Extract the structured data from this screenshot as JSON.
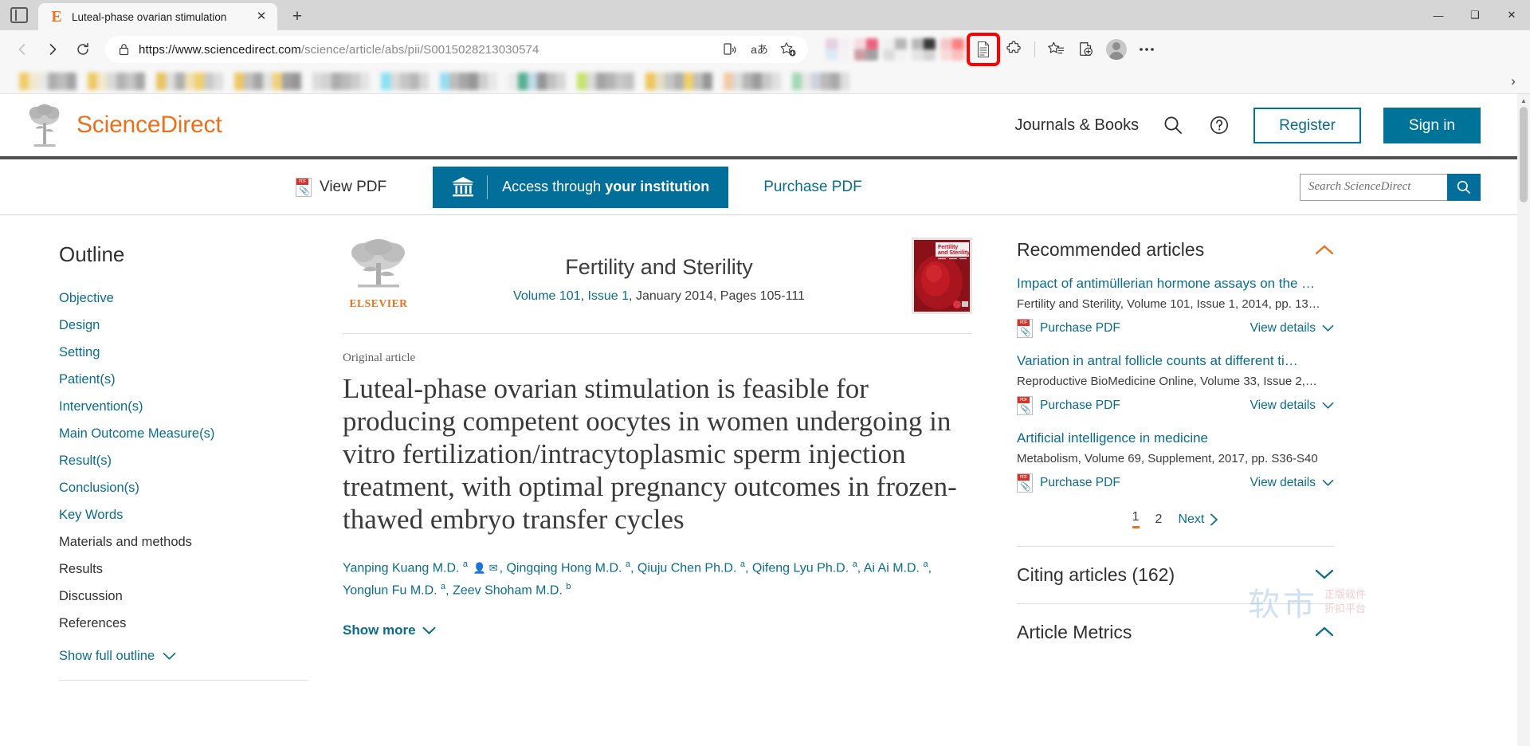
{
  "browser": {
    "tab": {
      "title": "Luteal-phase ovarian stimulation",
      "favicon": "E",
      "close": "✕"
    },
    "new_tab": "+",
    "window_controls": {
      "minimize": "—",
      "maximize": "❑",
      "close": "✕"
    },
    "nav": {
      "back": "←",
      "forward": "→",
      "reload": "↻"
    },
    "omnibox": {
      "lock": "lock-icon",
      "url_host": "https://www.sciencedirect.com",
      "url_path": "/science/article/abs/pii/S0015028213030574",
      "read_aloud": "read-aloud-icon",
      "translate": "aあ",
      "favorite": "favorite-add-icon"
    },
    "toolbar": {
      "reading_view": "reading-view-icon",
      "extensions": "extensions-icon",
      "favorites": "favorites-icon",
      "collections": "collections-icon",
      "profile": "profile-avatar",
      "settings": "settings-more-icon"
    },
    "bookmarks_overflow": "›"
  },
  "site": {
    "brand": "ScienceDirect",
    "nav": {
      "journals_books": "Journals & Books",
      "search_icon": "search-icon",
      "help_icon": "help-icon",
      "register": "Register",
      "sign_in": "Sign in"
    },
    "action_bar": {
      "view_pdf": "View PDF",
      "access_prefix": "Access through ",
      "access_bold": "your institution",
      "purchase_pdf": "Purchase PDF",
      "search_placeholder": "Search ScienceDirect",
      "search_value": "Search ScienceDirect",
      "search_button": "search-icon"
    }
  },
  "outline": {
    "title": "Outline",
    "items": [
      {
        "label": "Objective",
        "link": true
      },
      {
        "label": "Design",
        "link": true
      },
      {
        "label": "Setting",
        "link": true
      },
      {
        "label": "Patient(s)",
        "link": true
      },
      {
        "label": "Intervention(s)",
        "link": true
      },
      {
        "label": "Main Outcome Measure(s)",
        "link": true
      },
      {
        "label": "Result(s)",
        "link": true
      },
      {
        "label": "Conclusion(s)",
        "link": true
      },
      {
        "label": "Key Words",
        "link": true
      },
      {
        "label": "Materials and methods",
        "link": false
      },
      {
        "label": "Results",
        "link": false
      },
      {
        "label": "Discussion",
        "link": false
      },
      {
        "label": "References",
        "link": false
      }
    ],
    "show_full": "Show full outline"
  },
  "article": {
    "publisher": "ELSEVIER",
    "journal_name": "Fertility and Sterility",
    "volume": "Volume 101",
    "issue": "Issue 1",
    "volume_rest": ", January 2014, Pages 105-111",
    "cover_title_line1": "Fertility",
    "cover_title_line2": "and Sterility",
    "type": "Original article",
    "title": "Luteal-phase ovarian stimulation is feasible for producing competent oocytes in women undergoing in vitro fertilization/intracytoplasmic sperm injection treatment, with optimal pregnancy outcomes in frozen-thawed embryo transfer cycles",
    "authors": [
      {
        "name": "Yanping Kuang M.D.",
        "sup": "a",
        "corresponding": true
      },
      {
        "name": "Qingqing Hong M.D.",
        "sup": "a"
      },
      {
        "name": "Qiuju Chen Ph.D.",
        "sup": "a"
      },
      {
        "name": "Qifeng Lyu Ph.D.",
        "sup": "a"
      },
      {
        "name": "Ai Ai M.D.",
        "sup": "a"
      },
      {
        "name": "Yonglun Fu M.D.",
        "sup": "a"
      },
      {
        "name": "Zeev Shoham M.D.",
        "sup": "b"
      }
    ],
    "show_more": "Show more"
  },
  "recommended": {
    "heading": "Recommended articles",
    "collapse_icon": "chevron-up-icon",
    "items": [
      {
        "title": "Impact of antimüllerian hormone assays on the …",
        "source": "Fertility and Sterility, Volume 101, Issue 1, 2014, pp. 13…",
        "purchase": "Purchase PDF",
        "details": "View details"
      },
      {
        "title": "Variation in antral follicle counts at different ti…",
        "source": "Reproductive BioMedicine Online, Volume 33, Issue 2,…",
        "purchase": "Purchase PDF",
        "details": "View details"
      },
      {
        "title": "Artificial intelligence in medicine",
        "source": "Metabolism, Volume 69, Supplement, 2017, pp. S36-S40",
        "purchase": "Purchase PDF",
        "details": "View details"
      }
    ],
    "pager": {
      "page1": "1",
      "page2": "2",
      "next": "Next"
    }
  },
  "sidebar_sections": {
    "citing_articles": "Citing articles (162)",
    "article_metrics": "Article Metrics"
  },
  "watermark": {
    "cn_main": "软市",
    "cn_line1": "正版软件",
    "cn_line2": "折扣平台"
  },
  "colors": {
    "brand_orange": "#e9711c",
    "link_blue": "#0b6c8c",
    "accent_teal": "#026f9a",
    "highlight_red": "#ff0000"
  }
}
